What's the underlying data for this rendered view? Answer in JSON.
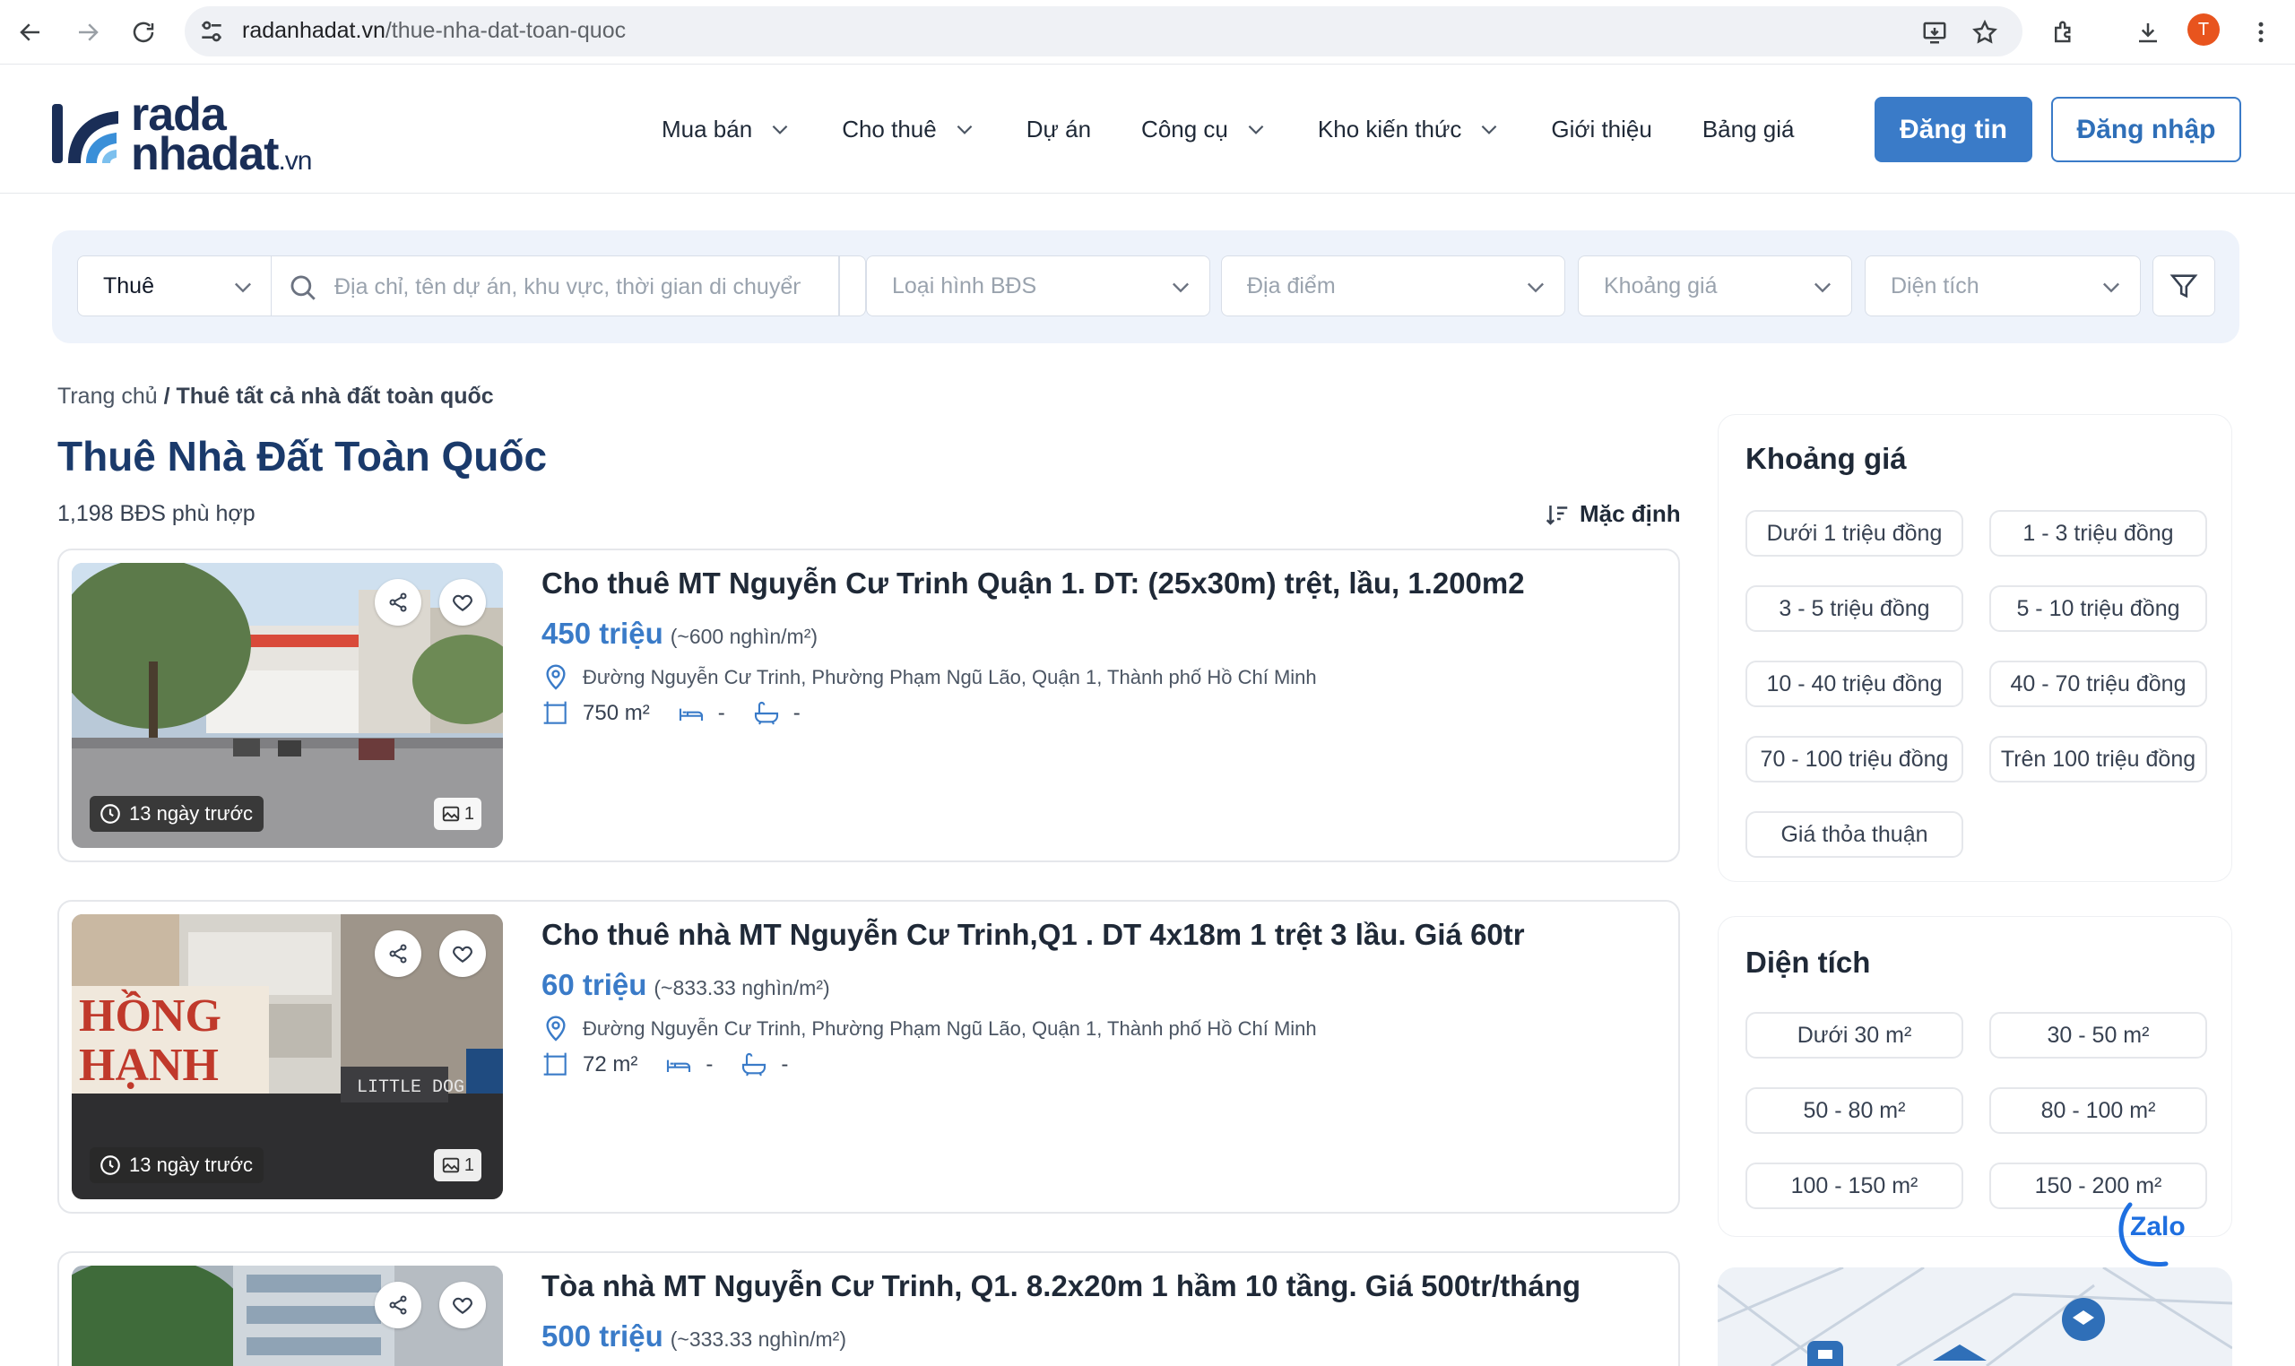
{
  "browser": {
    "url_host": "radanhadat.vn",
    "url_path": "/thue-nha-dat-toan-quoc",
    "profile_initial": "T"
  },
  "header": {
    "logo_line1": "rada",
    "logo_line2": "nhadat",
    "logo_suffix": ".vn",
    "nav": [
      {
        "label": "Mua bán",
        "has_dropdown": true
      },
      {
        "label": "Cho thuê",
        "has_dropdown": true
      },
      {
        "label": "Dự án",
        "has_dropdown": false
      },
      {
        "label": "Công cụ",
        "has_dropdown": true
      },
      {
        "label": "Kho kiến thức",
        "has_dropdown": true
      },
      {
        "label": "Giới thiệu",
        "has_dropdown": false
      },
      {
        "label": "Bảng giá",
        "has_dropdown": false
      }
    ],
    "post_label": "Đăng tin",
    "login_label": "Đăng nhập"
  },
  "search": {
    "mode": "Thuê",
    "placeholder": "Địa chỉ, tên dự án, khu vực, thời gian di chuyển",
    "type_placeholder": "Loại hình BĐS",
    "location_placeholder": "Địa điểm",
    "price_placeholder": "Khoảng giá",
    "area_placeholder": "Diện tích"
  },
  "breadcrumb": {
    "home": "Trang chủ",
    "separator": "/",
    "current": "Thuê tất cả nhà đất toàn quốc"
  },
  "page": {
    "title": "Thuê Nhà Đất Toàn Quốc",
    "result_count": "1,198 BĐS phù hợp",
    "sort_label": "Mặc định"
  },
  "listings": [
    {
      "title": "Cho thuê MT Nguyễn Cư Trinh Quận 1. DT: (25x30m) trệt, lầu, 1.200m2",
      "price": "450 triệu",
      "unit_price": "(~600 nghìn/m²)",
      "address": "Đường Nguyễn Cư Trinh, Phường Phạm Ngũ Lão, Quận 1, Thành phố Hồ Chí Minh",
      "area": "750 m²",
      "bedrooms": "-",
      "bathrooms": "-",
      "posted": "13 ngày trước",
      "image_count": "1"
    },
    {
      "title": "Cho thuê nhà MT Nguyễn Cư Trinh,Q1 . DT 4x18m 1 trệt 3 lầu. Giá 60tr",
      "price": "60 triệu",
      "unit_price": "(~833.33 nghìn/m²)",
      "address": "Đường Nguyễn Cư Trinh, Phường Phạm Ngũ Lão, Quận 1, Thành phố Hồ Chí Minh",
      "area": "72 m²",
      "bedrooms": "-",
      "bathrooms": "-",
      "posted": "13 ngày trước",
      "image_count": "1"
    },
    {
      "title": "Tòa nhà MT Nguyễn Cư Trinh, Q1. 8.2x20m 1 hầm 10 tầng. Giá 500tr/tháng",
      "price": "500 triệu",
      "unit_price": "(~333.33 nghìn/m²)"
    }
  ],
  "sidebar": {
    "price_title": "Khoảng giá",
    "price_ranges": [
      "Dưới 1 triệu đồng",
      "1 - 3 triệu đồng",
      "3 - 5 triệu đồng",
      "5 - 10 triệu đồng",
      "10 - 40 triệu đồng",
      "40 - 70 triệu đồng",
      "70 - 100 triệu đồng",
      "Trên 100 triệu đồng",
      "Giá thỏa thuận"
    ],
    "area_title": "Diện tích",
    "area_ranges": [
      "Dưới 30 m²",
      "30 - 50 m²",
      "50 - 80 m²",
      "80 - 100 m²",
      "100 - 150 m²",
      "150 - 200 m²"
    ]
  },
  "zalo_label": "Zalo",
  "colors": {
    "brand_blue": "#3a7bc8",
    "title_navy": "#1a3a6b",
    "logo_navy": "#1a2e57"
  }
}
